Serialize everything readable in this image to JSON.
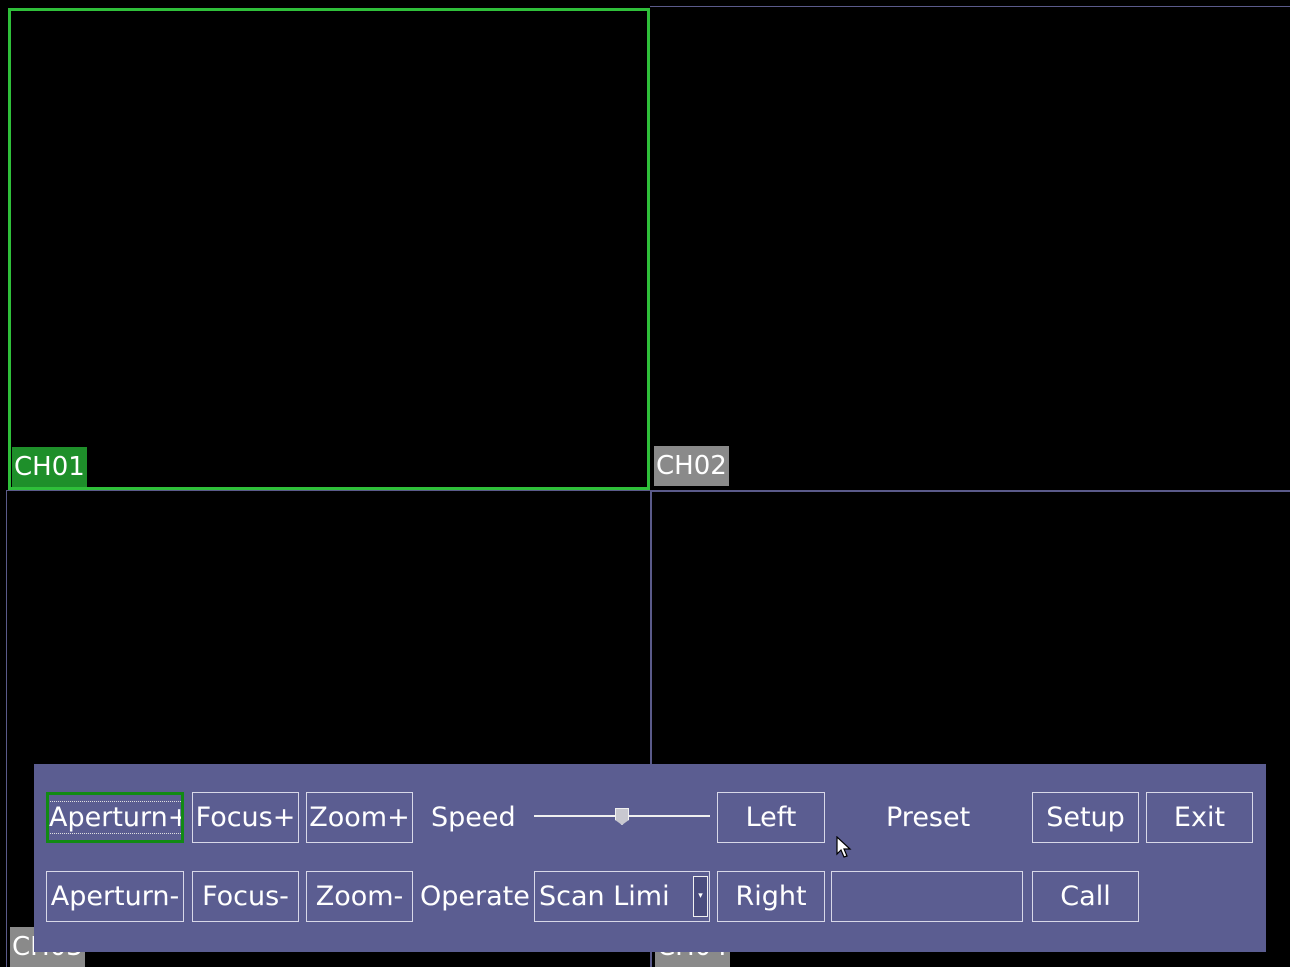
{
  "channels": [
    {
      "label": "CH01"
    },
    {
      "label": "CH02"
    },
    {
      "label": "CH03"
    },
    {
      "label": "CH04"
    }
  ],
  "ptz": {
    "row1": {
      "aperture_plus": "Aperturn+",
      "focus_plus": "Focus+",
      "zoom_plus": "Zoom+",
      "speed_label": "Speed",
      "left": "Left",
      "preset_label": "Preset",
      "setup": "Setup",
      "exit": "Exit"
    },
    "row2": {
      "aperture_minus": "Aperturn-",
      "focus_minus": "Focus-",
      "zoom_minus": "Zoom-",
      "operate_label": "Operate",
      "operate_value": "Scan Limi",
      "right": "Right",
      "preset_value": "",
      "call": "Call"
    },
    "speed_level": 0.5
  },
  "colors": {
    "selected_border": "#2fbf3a",
    "panel_bg": "#5b5d91",
    "focus_border": "#118a14"
  },
  "icons": {
    "cursor": "mouse-pointer-icon",
    "dropdown": "chevron-down-icon"
  }
}
